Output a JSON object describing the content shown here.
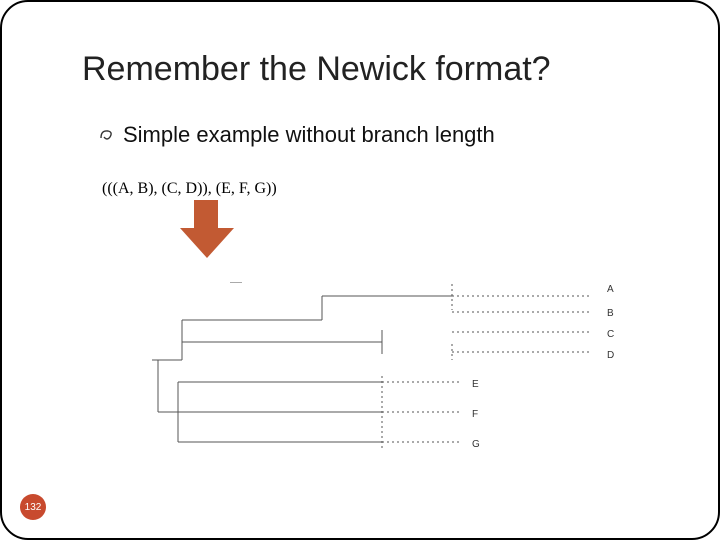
{
  "title": "Remember the Newick format?",
  "bullet": "Simple example without branch length",
  "newick_string": "(((A, B), (C, D)), (E, F, G))",
  "tree_labels": {
    "a": "A",
    "b": "B",
    "c": "C",
    "d": "D",
    "e": "E",
    "f": "F",
    "g": "G"
  },
  "page_number": "132",
  "arrow_color": "#c25a33"
}
